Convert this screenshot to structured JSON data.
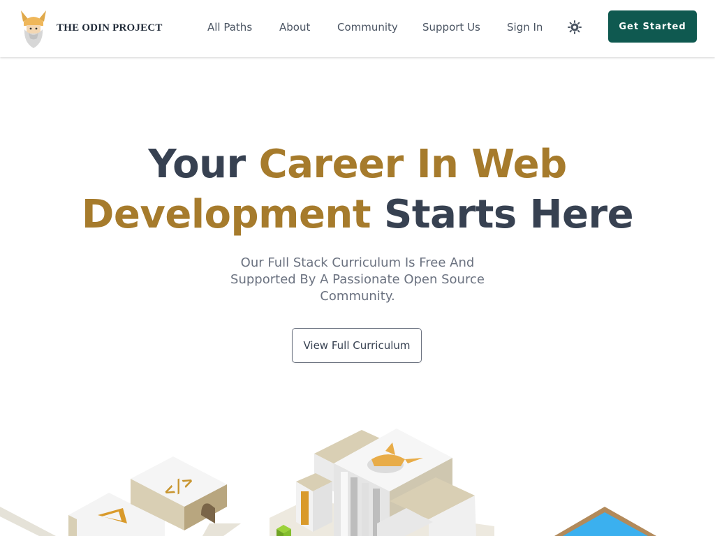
{
  "nav": {
    "logo_text": "THE ODIN PROJECT",
    "links": [
      "All Paths",
      "About",
      "Community",
      "Support Us",
      "Sign In"
    ],
    "theme_icon": "sun-icon",
    "cta_label": "Get Started"
  },
  "hero": {
    "title_part1": "Your ",
    "title_highlight1": "Career In Web",
    "title_highlight2": "Development",
    "title_part2": " Starts Here",
    "subtitle": "Our Full Stack Curriculum Is Free And Supported By A Passionate Open Source Community.",
    "cta_label": "View Full Curriculum"
  },
  "colors": {
    "brand_gold": "#a67b2c",
    "primary_green": "#0f5950",
    "heading_dark": "#374151",
    "text_muted": "#6b7280"
  }
}
